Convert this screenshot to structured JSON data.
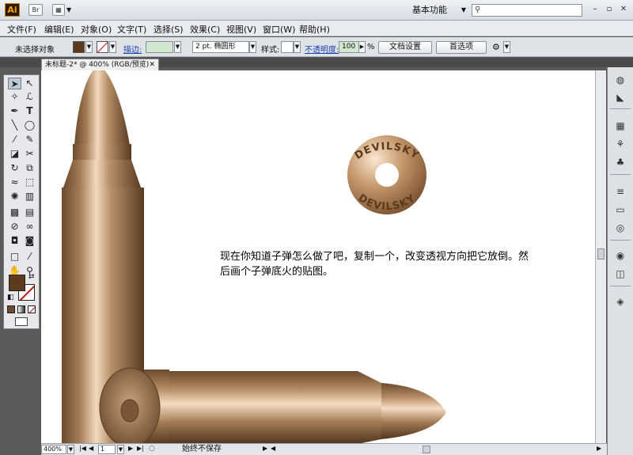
{
  "app": {
    "logo": "Ai",
    "toolbar_icon_1": "Br",
    "workspace": "基本功能",
    "search_placeholder": ""
  },
  "menu": {
    "items": [
      "文件(F)",
      "编辑(E)",
      "对象(O)",
      "文字(T)",
      "选择(S)",
      "效果(C)",
      "视图(V)",
      "窗口(W)",
      "帮助(H)"
    ]
  },
  "control": {
    "no_selection": "未选择对象",
    "stroke_label": "描边:",
    "brush_value": "2 pt. 椭圆形",
    "style_label": "样式:",
    "opacity_label": "不透明度:",
    "opacity_value": "100",
    "opacity_unit": "%",
    "doc_setup_button": "文档设置",
    "preferences_button": "首选项"
  },
  "tab": {
    "title": "未标题-2* @ 400% (RGB/预览)"
  },
  "artwork": {
    "coin_text_top": "DEVILSKY",
    "coin_text_bottom": "DEVILSKY",
    "annotation": "现在你知道子弹怎么做了吧，复制一个，改变透视方向把它放倒。然后画个子弹底火的贴图。"
  },
  "status": {
    "zoom": "400%",
    "page": "1",
    "message": "始终不保存"
  },
  "colors": {
    "fill": "#5e3a1d",
    "stroke_none": "#d01010",
    "bronze_dark": "#6b4a2c",
    "bronze_light": "#f3d9bd"
  }
}
